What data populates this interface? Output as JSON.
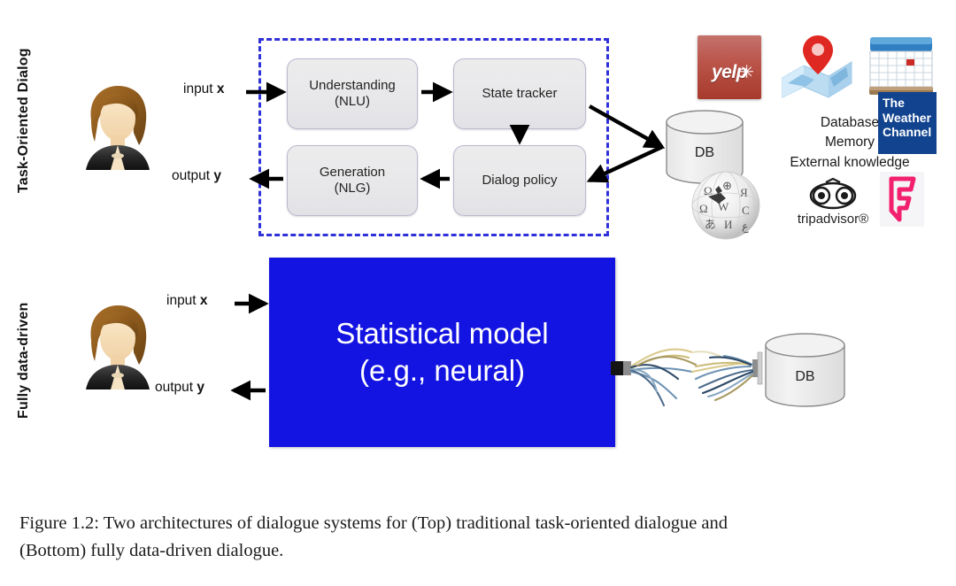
{
  "figure": {
    "caption_line1": "Figure 1.2:  Two architectures of dialogue systems for (Top) traditional task-oriented dialogue and",
    "caption_line2": "(Bottom) fully data-driven dialogue.",
    "colors": {
      "dashed_border": "#2f30d8",
      "statistical_model_box": "#1414e2",
      "pipeline_box_fill": "#e8e8ea",
      "weather_channel_blue": "#12438f",
      "yelp_red": "#a73a2c",
      "foursquare_pink": "#f2206e"
    }
  },
  "top_section": {
    "side_label": "Task-Oriented Dialog",
    "user_avatar": "user-avatar",
    "input_label_prefix": "input ",
    "input_label_var": "x",
    "output_label_prefix": "output ",
    "output_label_var": "y",
    "pipeline": [
      {
        "name": "nlu",
        "line1": "Understanding",
        "line2": "(NLU)"
      },
      {
        "name": "state-tracker",
        "line1": "State tracker",
        "line2": ""
      },
      {
        "name": "nlg",
        "line1": "Generation",
        "line2": "(NLG)"
      },
      {
        "name": "dialog-policy",
        "line1": "Dialog policy",
        "line2": ""
      }
    ],
    "database": {
      "label": "DB"
    },
    "knowledge_lines": [
      "Database",
      "Memory",
      "External knowledge"
    ],
    "logos": [
      {
        "name": "yelp-logo",
        "word": "yelp",
        "burst": "✳"
      },
      {
        "name": "maps-logo",
        "word": ""
      },
      {
        "name": "calendar-logo",
        "word": ""
      },
      {
        "name": "weather-channel-logo",
        "line1": "The",
        "line2": "Weather",
        "line3": "Channel"
      },
      {
        "name": "wikipedia-logo",
        "word": ""
      },
      {
        "name": "tripadvisor-logo",
        "word": "tripadvisor®"
      },
      {
        "name": "foursquare-logo",
        "word": ""
      }
    ]
  },
  "bottom_section": {
    "side_label": "Fully data-driven",
    "user_avatar": "user-avatar",
    "input_label_prefix": "input ",
    "input_label_var": "x",
    "output_label_prefix": "output ",
    "output_label_var": "y",
    "model_box_line1": "Statistical model",
    "model_box_line2": "(e.g., neural)",
    "database": {
      "label": "DB"
    },
    "connector": "frayed-cable"
  }
}
